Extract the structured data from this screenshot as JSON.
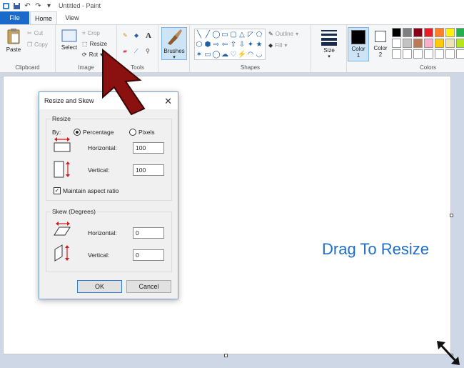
{
  "titlebar": {
    "title": "Untitled - Paint"
  },
  "tabs": {
    "file": "File",
    "home": "Home",
    "view": "View"
  },
  "ribbon": {
    "clipboard": {
      "paste": "Paste",
      "cut": "Cut",
      "copy": "Copy",
      "label": "Clipboard"
    },
    "image": {
      "select": "Select",
      "crop": "Crop",
      "resize": "Resize",
      "rotate": "Rot",
      "label": "Image"
    },
    "tools": {
      "label": "Tools"
    },
    "brushes": {
      "label": "Brushes"
    },
    "shapes": {
      "outline": "Outline",
      "fill": "Fill",
      "label": "Shapes",
      "icons": [
        "╲",
        "╱",
        "◯",
        "▭",
        "▢",
        "△",
        "◸",
        "⬠",
        "⬡",
        "⬢",
        "⇨",
        "⇦",
        "⇧",
        "⇩",
        "✦",
        "★",
        "✶",
        "▭",
        "◯",
        "☁",
        "♡",
        "⚡",
        "◠",
        "◡"
      ]
    },
    "size": {
      "label": "Size"
    },
    "color1": {
      "label": "Color",
      "sub": "1",
      "value": "#000000"
    },
    "color2": {
      "label": "Color",
      "sub": "2",
      "value": "#ffffff"
    },
    "colors": {
      "label": "Colors",
      "swatches": [
        "#000000",
        "#7f7f7f",
        "#880015",
        "#ed1c24",
        "#ff7f27",
        "#fff200",
        "#22b14c",
        "#ffffff",
        "#c3c3c3",
        "#b97a57",
        "#ffaec9",
        "#ffc90e",
        "#efe4b0",
        "#b5e61d",
        "#ffffff",
        "#ffffff",
        "#ffffff",
        "#ffffff",
        "#ffffff",
        "#ffffff",
        "#ffffff"
      ]
    }
  },
  "dialog": {
    "title": "Resize and Skew",
    "resize": {
      "legend": "Resize",
      "by": "By:",
      "percentage": "Percentage",
      "pixels": "Pixels",
      "horizontal_label": "Horizontal:",
      "horizontal_value": "100",
      "vertical_label": "Vertical:",
      "vertical_value": "100",
      "maintain": "Maintain aspect ratio"
    },
    "skew": {
      "legend": "Skew (Degrees)",
      "horizontal_label": "Horizontal:",
      "horizontal_value": "0",
      "vertical_label": "Vertical:",
      "vertical_value": "0"
    },
    "ok": "OK",
    "cancel": "Cancel"
  },
  "annotation": {
    "drag_label": "Drag To Resize"
  },
  "colors": {
    "accent": "#1b6ac9",
    "annotation_arrow": "#8b1010",
    "annotation_text": "#1e6fc8"
  }
}
